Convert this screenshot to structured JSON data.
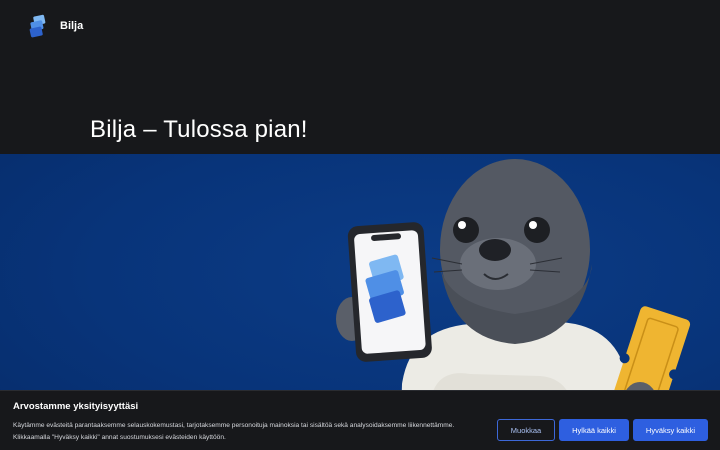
{
  "header": {
    "brand_name": "Bilja",
    "logo_icon": "bilja-logo-icon"
  },
  "hero": {
    "title": "Bilja – Tulossa pian!"
  },
  "banner": {
    "illustration": "seal-mascot-with-phone-and-ticket",
    "background_color": "#08347a"
  },
  "cookie_banner": {
    "title": "Arvostamme yksityisyyttäsi",
    "text_line1": "Käytämme evästeitä parantaaksemme selauskokemustasi, tarjotaksemme personoituja mainoksia tai sisältöä sekä analysoidaksemme liikennettämme.",
    "text_line2": "Klikkaamalla \"Hyväksy kaikki\" annat suostumuksesi evästeiden käyttöön.",
    "edit_label": "Muokkaa",
    "reject_label": "Hylkää kaikki",
    "accept_label": "Hyväksy kaikki"
  },
  "colors": {
    "page_bg": "#17181b",
    "accent": "#2e5fe0"
  }
}
